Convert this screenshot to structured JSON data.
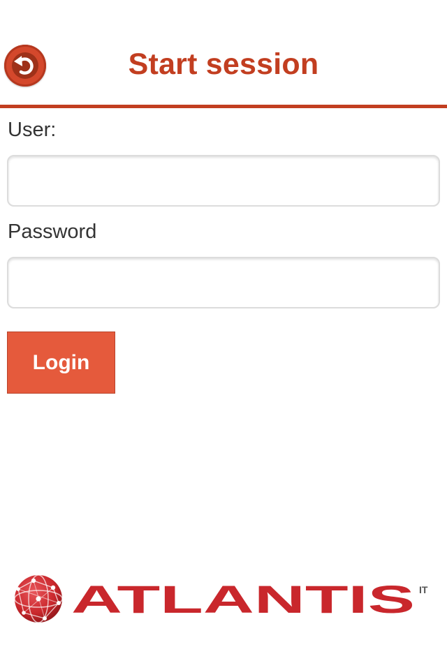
{
  "header": {
    "title": "Start session",
    "back_icon": "back-arrow-icon"
  },
  "form": {
    "user_label": "User:",
    "user_value": "",
    "password_label": "Password",
    "password_value": "",
    "login_label": "Login"
  },
  "logo": {
    "brand": "ATLANTIS",
    "superscript": "IT",
    "globe_icon": "globe-icon"
  },
  "colors": {
    "accent": "#c23e20",
    "button": "#e55a3c",
    "logo_red": "#c9272c"
  }
}
